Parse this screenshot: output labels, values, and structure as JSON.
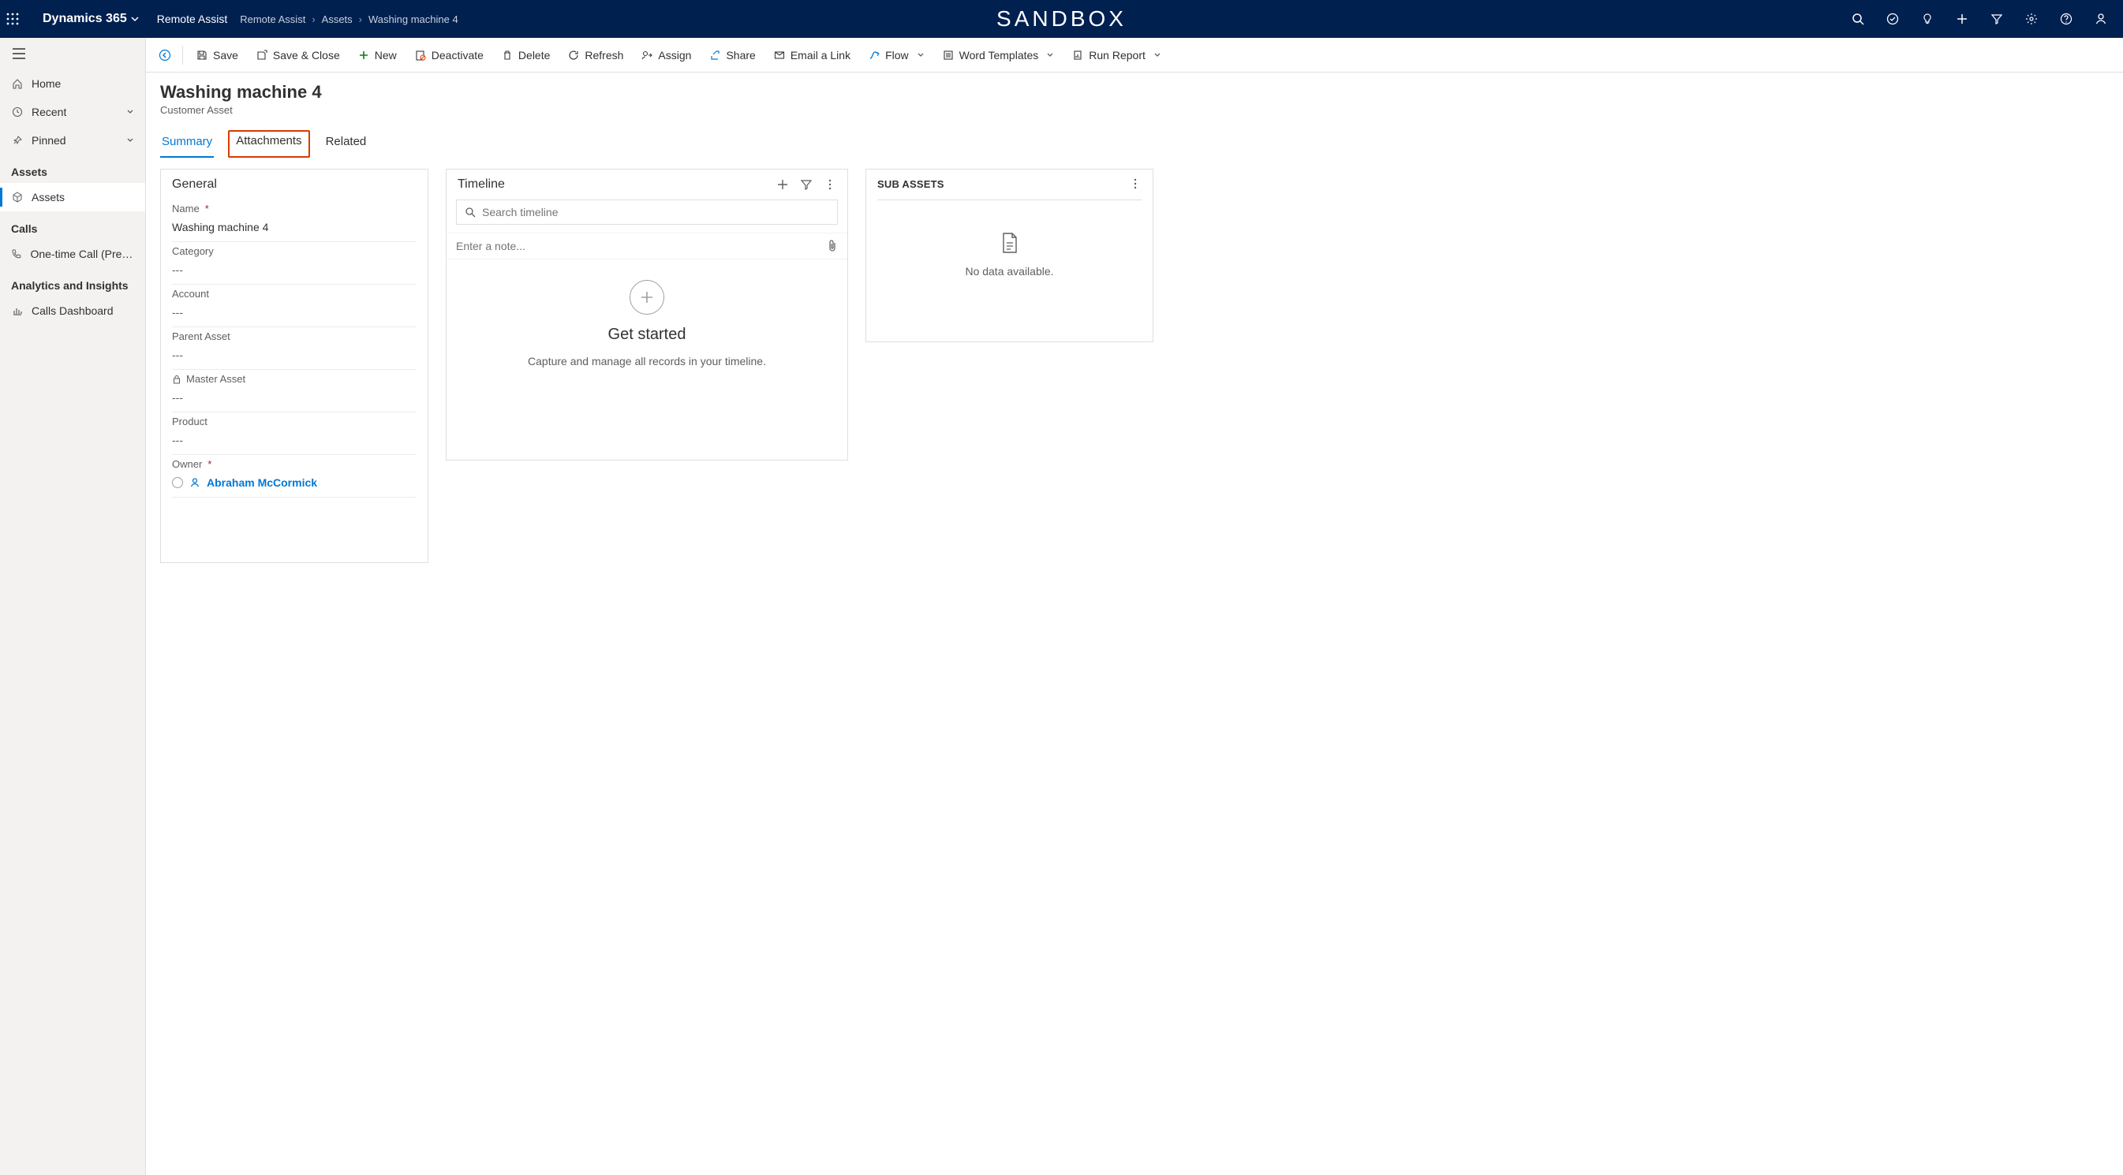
{
  "topbar": {
    "brand": "Dynamics 365",
    "app": "Remote Assist",
    "sandbox": "SANDBOX",
    "breadcrumb": [
      "Remote Assist",
      "Assets",
      "Washing machine 4"
    ]
  },
  "sidebar": {
    "items": {
      "home": "Home",
      "recent": "Recent",
      "pinned": "Pinned"
    },
    "groups": {
      "assets": {
        "title": "Assets",
        "items": [
          "Assets"
        ]
      },
      "calls": {
        "title": "Calls",
        "items": [
          "One-time Call (Previe..."
        ]
      },
      "analytics": {
        "title": "Analytics and Insights",
        "items": [
          "Calls Dashboard"
        ]
      }
    }
  },
  "commands": {
    "save": "Save",
    "save_close": "Save & Close",
    "new": "New",
    "deactivate": "Deactivate",
    "delete": "Delete",
    "refresh": "Refresh",
    "assign": "Assign",
    "share": "Share",
    "email_link": "Email a Link",
    "flow": "Flow",
    "word_templates": "Word Templates",
    "run_report": "Run Report"
  },
  "page": {
    "title": "Washing machine  4",
    "subtitle": "Customer Asset",
    "tabs": {
      "summary": "Summary",
      "attachments": "Attachments",
      "related": "Related"
    }
  },
  "general": {
    "section": "General",
    "name_label": "Name",
    "name_value": "Washing machine  4",
    "category_label": "Category",
    "category_value": "---",
    "account_label": "Account",
    "account_value": "---",
    "parent_label": "Parent Asset",
    "parent_value": "---",
    "master_label": "Master Asset",
    "master_value": "---",
    "product_label": "Product",
    "product_value": "---",
    "owner_label": "Owner",
    "owner_value": "Abraham McCormick"
  },
  "timeline": {
    "title": "Timeline",
    "search_placeholder": "Search timeline",
    "note_placeholder": "Enter a note...",
    "get_started": "Get started",
    "subtext": "Capture and manage all records in your timeline."
  },
  "subassets": {
    "title": "SUB ASSETS",
    "empty": "No data available."
  }
}
